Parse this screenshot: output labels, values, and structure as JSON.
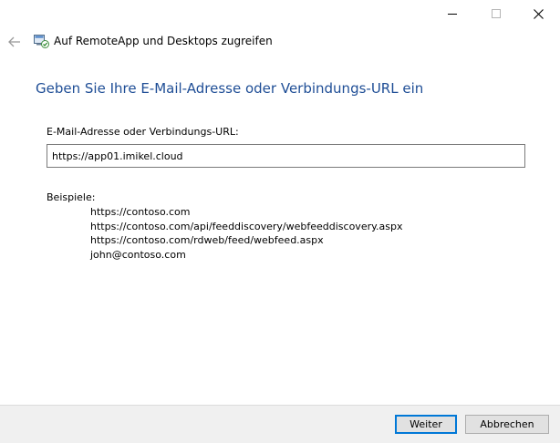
{
  "window": {
    "title": "Auf RemoteApp und Desktops zugreifen",
    "controls": {
      "minimize_icon": "minimize-icon",
      "maximize_icon": "maximize-icon",
      "close_icon": "close-icon"
    },
    "back_icon": "arrow-left-icon",
    "app_icon": "remote-desktop-icon"
  },
  "main": {
    "heading": "Geben Sie Ihre E-Mail-Adresse oder Verbindungs-URL ein",
    "field_label": "E-Mail-Adresse oder Verbindungs-URL:",
    "field_value": "https://app01.imikel.cloud",
    "examples_label": "Beispiele:",
    "examples": [
      "https://contoso.com",
      "https://contoso.com/api/feeddiscovery/webfeeddiscovery.aspx",
      "https://contoso.com/rdweb/feed/webfeed.aspx",
      "john@contoso.com"
    ]
  },
  "footer": {
    "next_label": "Weiter",
    "cancel_label": "Abbrechen"
  },
  "colors": {
    "heading": "#1f4e96",
    "accent": "#0078d7",
    "footer_bg": "#f0f0f0"
  }
}
